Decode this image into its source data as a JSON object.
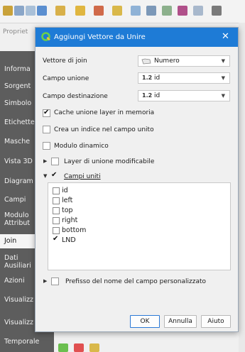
{
  "background": {
    "properties_title": "Propriet",
    "sidebar_items": [
      {
        "label": "Informa"
      },
      {
        "label": "Sorgent"
      },
      {
        "label": "Simbolo"
      },
      {
        "label": "Etichette"
      },
      {
        "label": "Masche"
      },
      {
        "label": "Vista 3D"
      },
      {
        "label": "Diagram"
      },
      {
        "label": "Campi"
      },
      {
        "label": "Modulo Attribut"
      },
      {
        "label": "Join"
      },
      {
        "label": "Dati Ausiliari"
      },
      {
        "label": "Azioni"
      },
      {
        "label": "Visualizz"
      },
      {
        "label": "Visualizz"
      },
      {
        "label": "Temporale"
      }
    ]
  },
  "dialog": {
    "title": "Aggiungi Vettore da Unire",
    "close_glyph": "✕",
    "join_layer": {
      "label": "Vettore di join",
      "value": "Numero",
      "icon": "polygon-layer-icon"
    },
    "join_field": {
      "label": "Campo unione",
      "prefix": "1.2",
      "value": "id"
    },
    "target_field": {
      "label": "Campo destinazione",
      "prefix": "1.2",
      "value": "id"
    },
    "options": {
      "cache": {
        "label": "Cache unione layer in memoria",
        "checked": true
      },
      "index": {
        "label": "Crea un indice nel campo unito",
        "checked": false
      },
      "dynamic_form": {
        "label": "Modulo dinamico",
        "checked": false
      },
      "editable": {
        "label": "Layer di unione modificabile",
        "checked": false
      },
      "joined_fields": {
        "label": "Campi uniti",
        "checked": true
      },
      "prefix": {
        "label": "Prefisso del nome del campo personalizzato",
        "checked": false
      }
    },
    "fields": [
      {
        "name": "id",
        "checked": false
      },
      {
        "name": "left",
        "checked": false
      },
      {
        "name": "top",
        "checked": false
      },
      {
        "name": "right",
        "checked": false
      },
      {
        "name": "bottom",
        "checked": false
      },
      {
        "name": "LND",
        "checked": true
      }
    ],
    "buttons": {
      "ok": "OK",
      "cancel": "Annulla",
      "help": "Aiuto"
    }
  },
  "colors": {
    "titlebar": "#1e7bd6",
    "sidebar": "#5d5d5d",
    "qgis_green": "#56a03b"
  }
}
